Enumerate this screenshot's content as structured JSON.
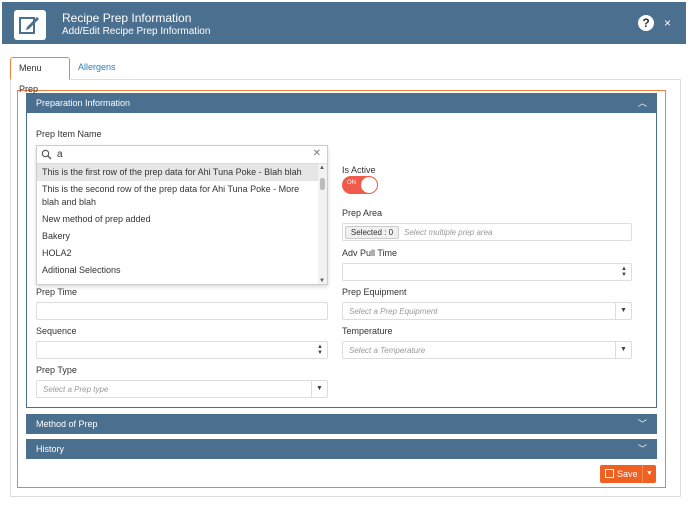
{
  "header": {
    "title": "Recipe Prep Information",
    "subtitle": "Add/Edit Recipe Prep Information",
    "help_glyph": "?",
    "close_glyph": "×"
  },
  "tabs": [
    {
      "label": "Menu Prep",
      "active": true
    },
    {
      "label": "Allergens",
      "active": false
    }
  ],
  "sections": {
    "preparation": "Preparation Information",
    "method": "Method of Prep",
    "history": "History"
  },
  "form": {
    "prep_item_name": {
      "label": "Prep Item Name",
      "search_value": "a"
    },
    "dropdown_items": [
      "This is the first row of the prep data for Ahi Tuna Poke - Blah blah",
      "This is the second row of the prep data for Ahi Tuna Poke - More blah and blah",
      "New method of prep added",
      "Bakery",
      "HOLA2",
      "Aditional Selections"
    ],
    "is_active": {
      "label": "Is Active",
      "state": "ON"
    },
    "prep_area": {
      "label": "Prep Area",
      "selected_text": "Selected : 0",
      "placeholder": "Select multiple prep area"
    },
    "adv_pull_time": {
      "label": "Adv Pull Time"
    },
    "prep_time": {
      "label": "Prep Time"
    },
    "prep_equipment": {
      "label": "Prep Equipment",
      "placeholder": "Select a Prep Equipment"
    },
    "sequence": {
      "label": "Sequence"
    },
    "temperature": {
      "label": "Temperature",
      "placeholder": "Select a Temperature"
    },
    "prep_type": {
      "label": "Prep Type",
      "placeholder": "Select a Prep type"
    }
  },
  "footer": {
    "save_label": "Save"
  },
  "colors": {
    "header_bg": "#4a6f8f",
    "accent": "#f06020",
    "toggle_on": "#f05a4a",
    "link": "#2a7fc0"
  },
  "icons": {
    "logo": "edit-icon",
    "search": "search-icon",
    "clear": "close-icon",
    "save": "floppy-icon"
  }
}
